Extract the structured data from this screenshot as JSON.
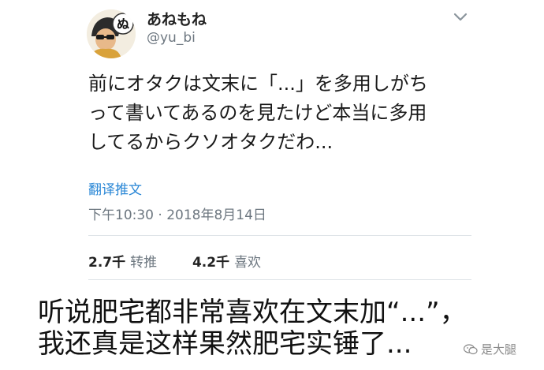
{
  "user": {
    "display_name": "あねもね",
    "handle": "@yu_bi",
    "avatar_glyph": "ぬ"
  },
  "tweet": {
    "lines": [
      "前にオタクは文末に「...」を多用しがち",
      "って書いてあるのを見たけど本当に多用",
      "してるからクソオタクだわ..."
    ],
    "translate_label": "翻译推文",
    "timestamp": "下午10:30 · 2018年8月14日"
  },
  "stats": {
    "retweets_count": "2.7千",
    "retweets_label": "转推",
    "likes_count": "4.2千",
    "likes_label": "喜欢"
  },
  "caption": {
    "lines": [
      "听说肥宅都非常喜欢在文末加“...”，",
      "我还真是这样果然肥宅实锤了..."
    ]
  },
  "watermark": {
    "text": "是大腿"
  },
  "colors": {
    "link": "#2a87d6",
    "muted": "#6d7780",
    "divider": "#dfe4e8"
  },
  "icons": {
    "menu": "chevron-down-icon",
    "watermark": "wechat-icon"
  }
}
